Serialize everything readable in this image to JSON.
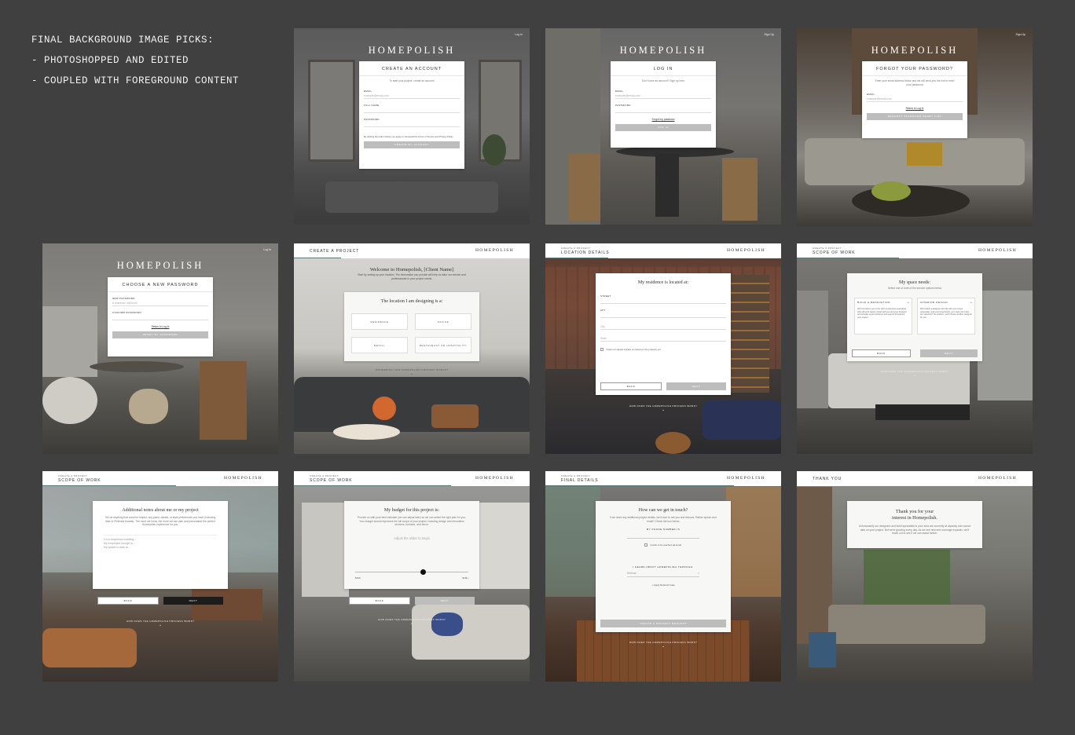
{
  "notes": {
    "title": "FINAL BACKGROUND IMAGE PICKS:",
    "line1": "- PHOTOSHOPPED AND EDITED",
    "line2": "- COUPLED WITH FOREGROUND CONTENT"
  },
  "brand": "HOMEPOLISH",
  "brand_header": "HOMEPOLISH",
  "login_link": "Log In",
  "signup_link": "Sign Up",
  "create_account": {
    "title": "CREATE AN ACCOUNT",
    "subtitle": "To start your project, create an account",
    "email_label": "EMAIL",
    "email_placeholder": "example@email.com",
    "name_label": "FULL NAME",
    "password_label": "PASSWORD",
    "terms": "By clicking the button below you agree to Homepolish's Terms of Service and Privacy Policy",
    "button": "CREATE MY ACCOUNT"
  },
  "log_in": {
    "title": "LOG IN",
    "subtitle": "Don't have an account? Sign up here",
    "email_label": "EMAIL",
    "email_placeholder": "example@email.com",
    "password_label": "PASSWORD",
    "forgot": "Forgot my password",
    "button": "LOG IN"
  },
  "forgot_password": {
    "title": "FORGOT YOUR PASSWORD?",
    "subtitle": "Enter your email address below and we will send you the link to reset your password",
    "email_label": "EMAIL",
    "email_placeholder": "example@email.com",
    "return": "Return to Log In",
    "button": "REQUEST PASSWORD RESET LINK"
  },
  "new_password": {
    "title": "CHOOSE A NEW PASSWORD",
    "new_label": "NEW PASSWORD",
    "new_placeholder": "8 character minimum",
    "confirm_label": "CONFIRM PASSWORD",
    "return": "Return to Log In",
    "button": "RESET MY PASSWORD"
  },
  "welcome": {
    "step": "CREATE A PROJECT",
    "title": "Welcome to Homepolish, [Client Name]",
    "subtitle": "Start by setting up your location. The information you provide will help us tailor our service and professionals to your project needs.",
    "question": "The location I am designing is a:",
    "options": [
      "RESIDENCE",
      "OFFICE",
      "RETAIL",
      "RESTAURANT OR HOSPITALITY"
    ],
    "how": "WONDERING HOW HOMEPOLISH PROCESS WORKS?"
  },
  "location": {
    "kicker": "CREATE A PROJECT",
    "step": "LOCATION DETAILS",
    "title": "My residence is located at:",
    "street_label": "STREET",
    "apt_label": "APT",
    "city": "City",
    "state": "State",
    "checkbox": "I have not signed a lease or closed on the property yet",
    "back": "BACK",
    "next": "NEXT",
    "how": "HOW DOES THE HOMEPOLISH PROCESS WORK?"
  },
  "space_needs": {
    "kicker": "CREATE A PROJECT",
    "step": "SCOPE OF WORK",
    "title": "My space needs:",
    "subtitle": "Select one or both of the service options below",
    "option1_title": "BUILD & RENOVATION",
    "option1_text": "We'll introduce you to the right construction specialists who will work hand in hand with you and your designer and actually expert solutions and support throughout your project.",
    "option2_title": "INTERIOR DESIGN",
    "option2_text": "We'll select a designer who fits with your scope, personality, and most importantly, your style. Don't like our selection? No problem, we'll choose another designer for you.",
    "back": "BACK",
    "next": "NEXT",
    "how": "HOW DOES THE HOMEPOLISH PROCESS WORK?"
  },
  "notes_step": {
    "kicker": "CREATE A PROJECT",
    "step": "SCOPE OF WORK",
    "title": "Additional notes about me or my project",
    "subtitle": "Tell us anything that could be helpful: any plans, details, or style preferences you have (including links to Pinterest boards). The more we know, the more we can plan and personalize the perfect Homepolish experience for you.",
    "placeholder1": "I'm a downtown building...",
    "placeholder2": "My employee lounge is...",
    "placeholder3": "My space is dark is...",
    "back": "BACK",
    "next": "NEXT",
    "how": "HOW DOES THE HOMEPOLISH PROCESS WORK?"
  },
  "budget": {
    "kicker": "CREATE A PROJECT",
    "step": "SCOPE OF WORK",
    "title": "My budget for this project is:",
    "subtitle": "Provide us with your best estimate (we can adjust later) so we can select the right plan for you. Your budget should represent the full scope of your project, including design and renovation services, furniture, and decor.",
    "slider_hint": "Adjust the slider to begin",
    "slider_value": 0.6,
    "min": "$10K",
    "max": "$1M+",
    "back": "BACK",
    "next": "NEXT",
    "how": "HOW DOES THE HOMEPOLISH PROCESS WORK?"
  },
  "final": {
    "kicker": "CREATE A PROJECT",
    "step": "FINAL DETAILS",
    "title": "How can we get in touch?",
    "subtitle": "If we need any additional project details, we'd love to call you and discuss. Rather speak over email? Check the box below.",
    "phone_label": "MY PHONE NUMBER IS",
    "email_check": "I prefer to be reached via email",
    "heard_label": "I HEARD ABOUT HOMEPOLISH THROUGH:",
    "select": "Referral",
    "referral": "+ Apply Referral Code",
    "button": "CREATE A PROJECT REQUEST",
    "how": "HOW DOES THE HOMEPOLISH PROCESS WORK?"
  },
  "thanks": {
    "step": "THANK YOU",
    "title1": "Thank you for your",
    "title2": "interest in Homepolish.",
    "body": "Unfortunately our designers and build specialists in your area are currently at capacity and cannot take on your project. But we're growing every day. As we see new and coverage expands, we'll reach out to see if we can assist further."
  }
}
